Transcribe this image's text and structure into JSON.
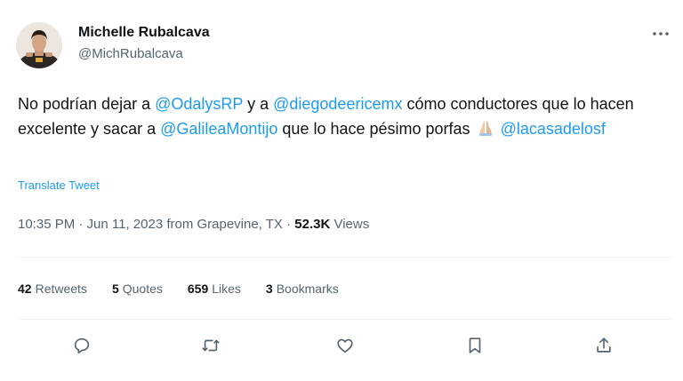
{
  "author": {
    "name": "Michelle Rubalcava",
    "handle": "@MichRubalcava"
  },
  "tweet": {
    "part1": "No podrían dejar a ",
    "mention1": "@OdalysRP",
    "part2": " y a ",
    "mention2": "@diegodeericemx",
    "part3": " cómo conductores que lo hacen excelente y sacar a ",
    "mention3": "@GalileaMontijo",
    "part4": " que lo hace pésimo porfas ",
    "emoji_icon": "folded-hands-icon",
    "mention4": "@lacasadelosf"
  },
  "translate_label": "Translate Tweet",
  "meta": {
    "time_date_location": "10:35 PM · Jun 11, 2023 from Grapevine, TX · ",
    "views_count": "52.3K",
    "views_label": " Views"
  },
  "stats": {
    "retweets_count": "42",
    "retweets_label": "Retweets",
    "quotes_count": "5",
    "quotes_label": "Quotes",
    "likes_count": "659",
    "likes_label": "Likes",
    "bookmarks_count": "3",
    "bookmarks_label": "Bookmarks"
  },
  "actions": [
    "reply-icon",
    "retweet-icon",
    "like-icon",
    "bookmark-icon",
    "share-icon"
  ],
  "colors": {
    "link": "#1d9bf0",
    "text": "#0f1419",
    "secondary": "#536471",
    "divider": "#eff3f4",
    "icon": "#536471"
  }
}
